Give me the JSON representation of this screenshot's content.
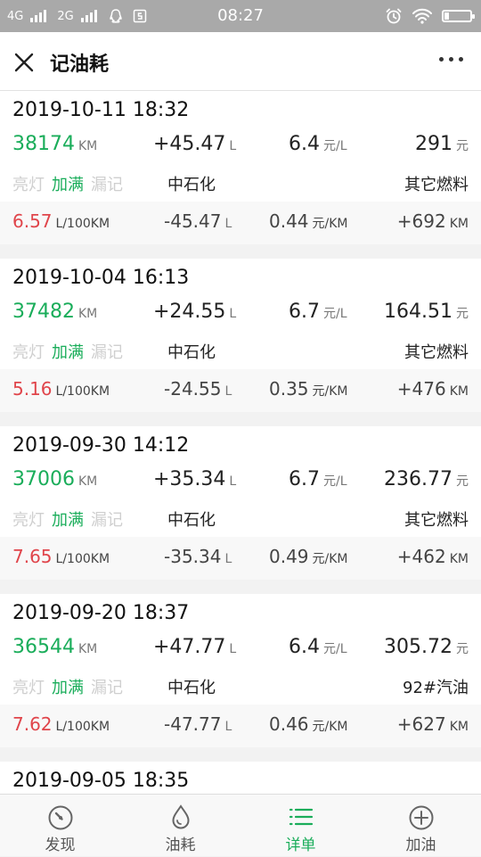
{
  "statusbar": {
    "net1": "4G",
    "net2": "2G",
    "time": "08:27"
  },
  "header": {
    "title": "记油耗"
  },
  "records": [
    {
      "date": "2019-10-11 18:32",
      "odometer": "38174",
      "odometer_unit": "KM",
      "volume": "+45.47",
      "volume_unit": "L",
      "price": "6.4",
      "price_unit": "元/L",
      "amount": "291",
      "amount_unit": "元",
      "tag_light": "亮灯",
      "tag_full": "加满",
      "tag_missed": "漏记",
      "station": "中石化",
      "fuel": "其它燃料",
      "consumption": "6.57",
      "consumption_unit": "L/100KM",
      "used": "-45.47",
      "used_unit": "L",
      "cost_per_km": "0.44",
      "cost_per_km_unit": "元/KM",
      "distance": "+692",
      "distance_unit": "KM"
    },
    {
      "date": "2019-10-04 16:13",
      "odometer": "37482",
      "odometer_unit": "KM",
      "volume": "+24.55",
      "volume_unit": "L",
      "price": "6.7",
      "price_unit": "元/L",
      "amount": "164.51",
      "amount_unit": "元",
      "tag_light": "亮灯",
      "tag_full": "加满",
      "tag_missed": "漏记",
      "station": "中石化",
      "fuel": "其它燃料",
      "consumption": "5.16",
      "consumption_unit": "L/100KM",
      "used": "-24.55",
      "used_unit": "L",
      "cost_per_km": "0.35",
      "cost_per_km_unit": "元/KM",
      "distance": "+476",
      "distance_unit": "KM"
    },
    {
      "date": "2019-09-30 14:12",
      "odometer": "37006",
      "odometer_unit": "KM",
      "volume": "+35.34",
      "volume_unit": "L",
      "price": "6.7",
      "price_unit": "元/L",
      "amount": "236.77",
      "amount_unit": "元",
      "tag_light": "亮灯",
      "tag_full": "加满",
      "tag_missed": "漏记",
      "station": "中石化",
      "fuel": "其它燃料",
      "consumption": "7.65",
      "consumption_unit": "L/100KM",
      "used": "-35.34",
      "used_unit": "L",
      "cost_per_km": "0.49",
      "cost_per_km_unit": "元/KM",
      "distance": "+462",
      "distance_unit": "KM"
    },
    {
      "date": "2019-09-20 18:37",
      "odometer": "36544",
      "odometer_unit": "KM",
      "volume": "+47.77",
      "volume_unit": "L",
      "price": "6.4",
      "price_unit": "元/L",
      "amount": "305.72",
      "amount_unit": "元",
      "tag_light": "亮灯",
      "tag_full": "加满",
      "tag_missed": "漏记",
      "station": "中石化",
      "fuel": "92#汽油",
      "consumption": "7.62",
      "consumption_unit": "L/100KM",
      "used": "-47.77",
      "used_unit": "L",
      "cost_per_km": "0.46",
      "cost_per_km_unit": "元/KM",
      "distance": "+627",
      "distance_unit": "KM"
    },
    {
      "date": "2019-09-05 18:35"
    }
  ],
  "nav": [
    {
      "label": "发现",
      "icon": "gauge-icon"
    },
    {
      "label": "油耗",
      "icon": "drop-icon"
    },
    {
      "label": "详单",
      "icon": "list-icon",
      "active": true
    },
    {
      "label": "加油",
      "icon": "add-circle-icon"
    }
  ],
  "colors": {
    "accent": "#1aad5a",
    "consumption": "#e0454b",
    "statusbar": "#a9a9a9"
  }
}
